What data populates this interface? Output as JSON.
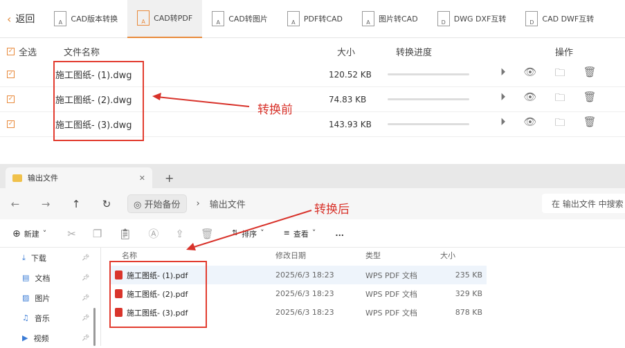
{
  "toolbar": {
    "back": "返回",
    "tools": [
      "CAD版本转换",
      "CAD转PDF",
      "CAD转图片",
      "PDF转CAD",
      "图片转CAD",
      "DWG DXF互转",
      "CAD DWF互转"
    ]
  },
  "table": {
    "headers": {
      "select_all": "全选",
      "name": "文件名称",
      "size": "大小",
      "progress": "转换进度",
      "ops": "操作"
    },
    "rows": [
      {
        "name": "施工图纸- (1).dwg",
        "size": "120.52 KB",
        "progress": 0
      },
      {
        "name": "施工图纸- (2).dwg",
        "size": "74.83 KB",
        "progress": 0
      },
      {
        "name": "施工图纸- (3).dwg",
        "size": "143.93 KB",
        "progress": 0
      }
    ]
  },
  "annotations": {
    "before": "转换前",
    "after": "转换后"
  },
  "explorer": {
    "tab": "输出文件",
    "breadcrumb": [
      "开始备份",
      "输出文件"
    ],
    "search_placeholder": "在 输出文件 中搜索",
    "toolbar": {
      "new": "新建",
      "sort": "排序",
      "view": "查看",
      "more": "..."
    },
    "sidebar": [
      {
        "label": "下载",
        "icon": "download-icon"
      },
      {
        "label": "文档",
        "icon": "document-icon"
      },
      {
        "label": "图片",
        "icon": "picture-icon"
      },
      {
        "label": "音乐",
        "icon": "music-icon"
      },
      {
        "label": "视频",
        "icon": "video-icon"
      }
    ],
    "columns": [
      "名称",
      "修改日期",
      "类型",
      "大小"
    ],
    "files": [
      {
        "name": "施工图纸- (1).pdf",
        "date": "2025/6/3 18:23",
        "type": "WPS PDF 文档",
        "size": "235 KB"
      },
      {
        "name": "施工图纸- (2).pdf",
        "date": "2025/6/3 18:23",
        "type": "WPS PDF 文档",
        "size": "329 KB"
      },
      {
        "name": "施工图纸- (3).pdf",
        "date": "2025/6/3 18:23",
        "type": "WPS PDF 文档",
        "size": "878 KB"
      }
    ]
  },
  "colors": {
    "accent": "#e8893a",
    "annotation": "#d8322a"
  }
}
